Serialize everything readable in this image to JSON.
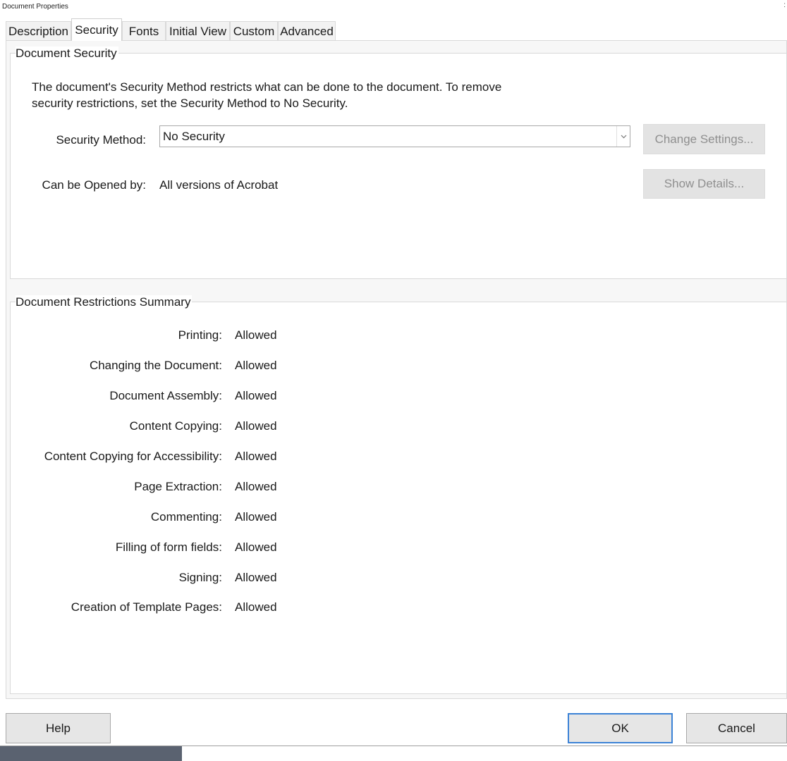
{
  "window": {
    "title": "Document Properties",
    "edge_glyph": ":"
  },
  "tabs": [
    {
      "label": "Description",
      "active": false
    },
    {
      "label": "Security",
      "active": true
    },
    {
      "label": "Fonts",
      "active": false
    },
    {
      "label": "Initial View",
      "active": false
    },
    {
      "label": "Custom",
      "active": false
    },
    {
      "label": "Advanced",
      "active": false
    }
  ],
  "security": {
    "group_title": "Document Security",
    "description": "The document's Security Method restricts what can be done to the document. To remove security restrictions, set the Security Method to No Security.",
    "method_label": "Security Method:",
    "method_value": "No Security",
    "change_settings_label": "Change Settings...",
    "opened_by_label": "Can be Opened by:",
    "opened_by_value": "All versions of Acrobat",
    "show_details_label": "Show Details..."
  },
  "restrictions": {
    "group_title": "Document Restrictions Summary",
    "items": [
      {
        "label": "Printing:",
        "value": "Allowed"
      },
      {
        "label": "Changing the Document:",
        "value": "Allowed"
      },
      {
        "label": "Document Assembly:",
        "value": "Allowed"
      },
      {
        "label": "Content Copying:",
        "value": "Allowed"
      },
      {
        "label": "Content Copying for Accessibility:",
        "value": "Allowed"
      },
      {
        "label": "Page Extraction:",
        "value": "Allowed"
      },
      {
        "label": "Commenting:",
        "value": "Allowed"
      },
      {
        "label": "Filling of form fields:",
        "value": "Allowed"
      },
      {
        "label": "Signing:",
        "value": "Allowed"
      },
      {
        "label": "Creation of Template Pages:",
        "value": "Allowed"
      }
    ]
  },
  "footer": {
    "help_label": "Help",
    "ok_label": "OK",
    "cancel_label": "Cancel"
  },
  "colors": {
    "default_button_border": "#3b82d6",
    "disabled_text": "#8f8f8f",
    "pane_background": "#f7f7f7"
  }
}
